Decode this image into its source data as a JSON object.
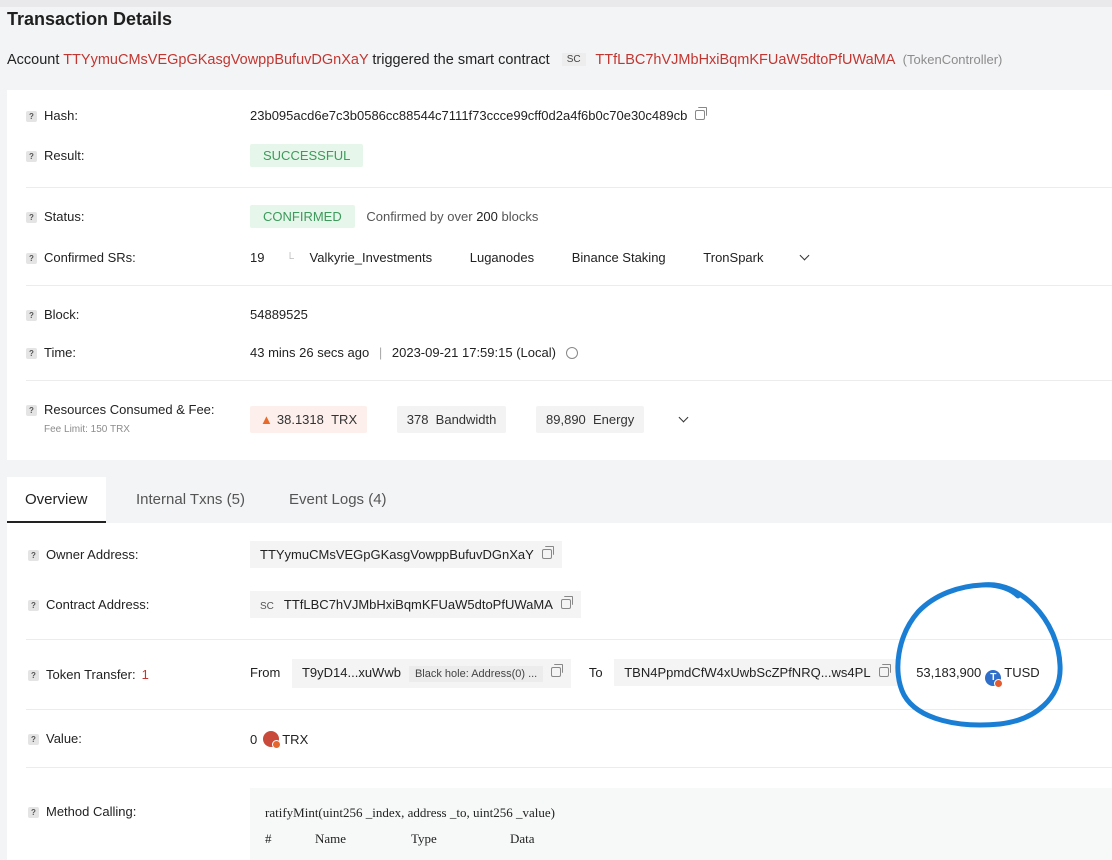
{
  "page": {
    "title": "Transaction Details"
  },
  "account_line": {
    "prefix": "Account",
    "account": "TTYymuCMsVEGpGKasgVowppBufuvDGnXaY",
    "middle": "triggered the smart contract",
    "sc_tag": "SC",
    "contract": "TTfLBC7hVJMbHxiBqmKFUaW5dtoPfUWaMA",
    "contract_name": "(TokenController)"
  },
  "details": {
    "hash_label": "Hash:",
    "hash": "23b095acd6e7c3b0586cc88544c7111f73ccce99cff0d2a4f6b0c70e30c489cb",
    "result_label": "Result:",
    "result": "SUCCESSFUL",
    "status_label": "Status:",
    "status": "CONFIRMED",
    "confirmed_by_prefix": "Confirmed by over",
    "confirmed_by_count": "200",
    "confirmed_by_suffix": "blocks",
    "srs_label": "Confirmed SRs:",
    "srs_count": "19",
    "srs": [
      "Valkyrie_Investments",
      "Luganodes",
      "Binance Staking",
      "TronSpark"
    ],
    "block_label": "Block:",
    "block": "54889525",
    "time_label": "Time:",
    "time_ago": "43 mins 26 secs ago",
    "time_sep": "|",
    "time_local": "2023-09-21 17:59:15 (Local)",
    "resources_label": "Resources Consumed & Fee:",
    "fee_limit": "Fee Limit: 150 TRX",
    "fee_value": "38.1318",
    "fee_unit": "TRX",
    "bandwidth_value": "378",
    "bandwidth_unit": "Bandwidth",
    "energy_value": "89,890",
    "energy_unit": "Energy"
  },
  "tabs": [
    {
      "label": "Overview",
      "active": true
    },
    {
      "label": "Internal Txns (5)",
      "active": false
    },
    {
      "label": "Event Logs (4)",
      "active": false
    }
  ],
  "overview": {
    "owner_label": "Owner Address:",
    "owner": "TTYymuCMsVEGpGKasgVowppBufuvDGnXaY",
    "contract_label": "Contract Address:",
    "contract_tag": "SC",
    "contract": "TTfLBC7hVJMbHxiBqmKFUaW5dtoPfUWaMA",
    "transfer_label": "Token Transfer:",
    "transfer_count": "1",
    "from_label": "From",
    "from_addr": "T9yD14...xuWwb",
    "from_tag": "Black hole: Address(0) ...",
    "to_label": "To",
    "to_addr": "TBN4PpmdCfW4xUwbScZPfNRQ...ws4PL",
    "amount": "53,183,900",
    "token": "TUSD",
    "value_label": "Value:",
    "value": "0",
    "value_unit": "TRX",
    "method_label": "Method Calling:",
    "method_sig": "ratifyMint(uint256 _index, address _to, uint256 _value)",
    "method_cols": [
      "#",
      "Name",
      "Type",
      "Data"
    ]
  },
  "colors": {
    "link_red": "#c23631",
    "success_green": "#3c9a5b",
    "annotation_blue": "#1a7fd4"
  }
}
